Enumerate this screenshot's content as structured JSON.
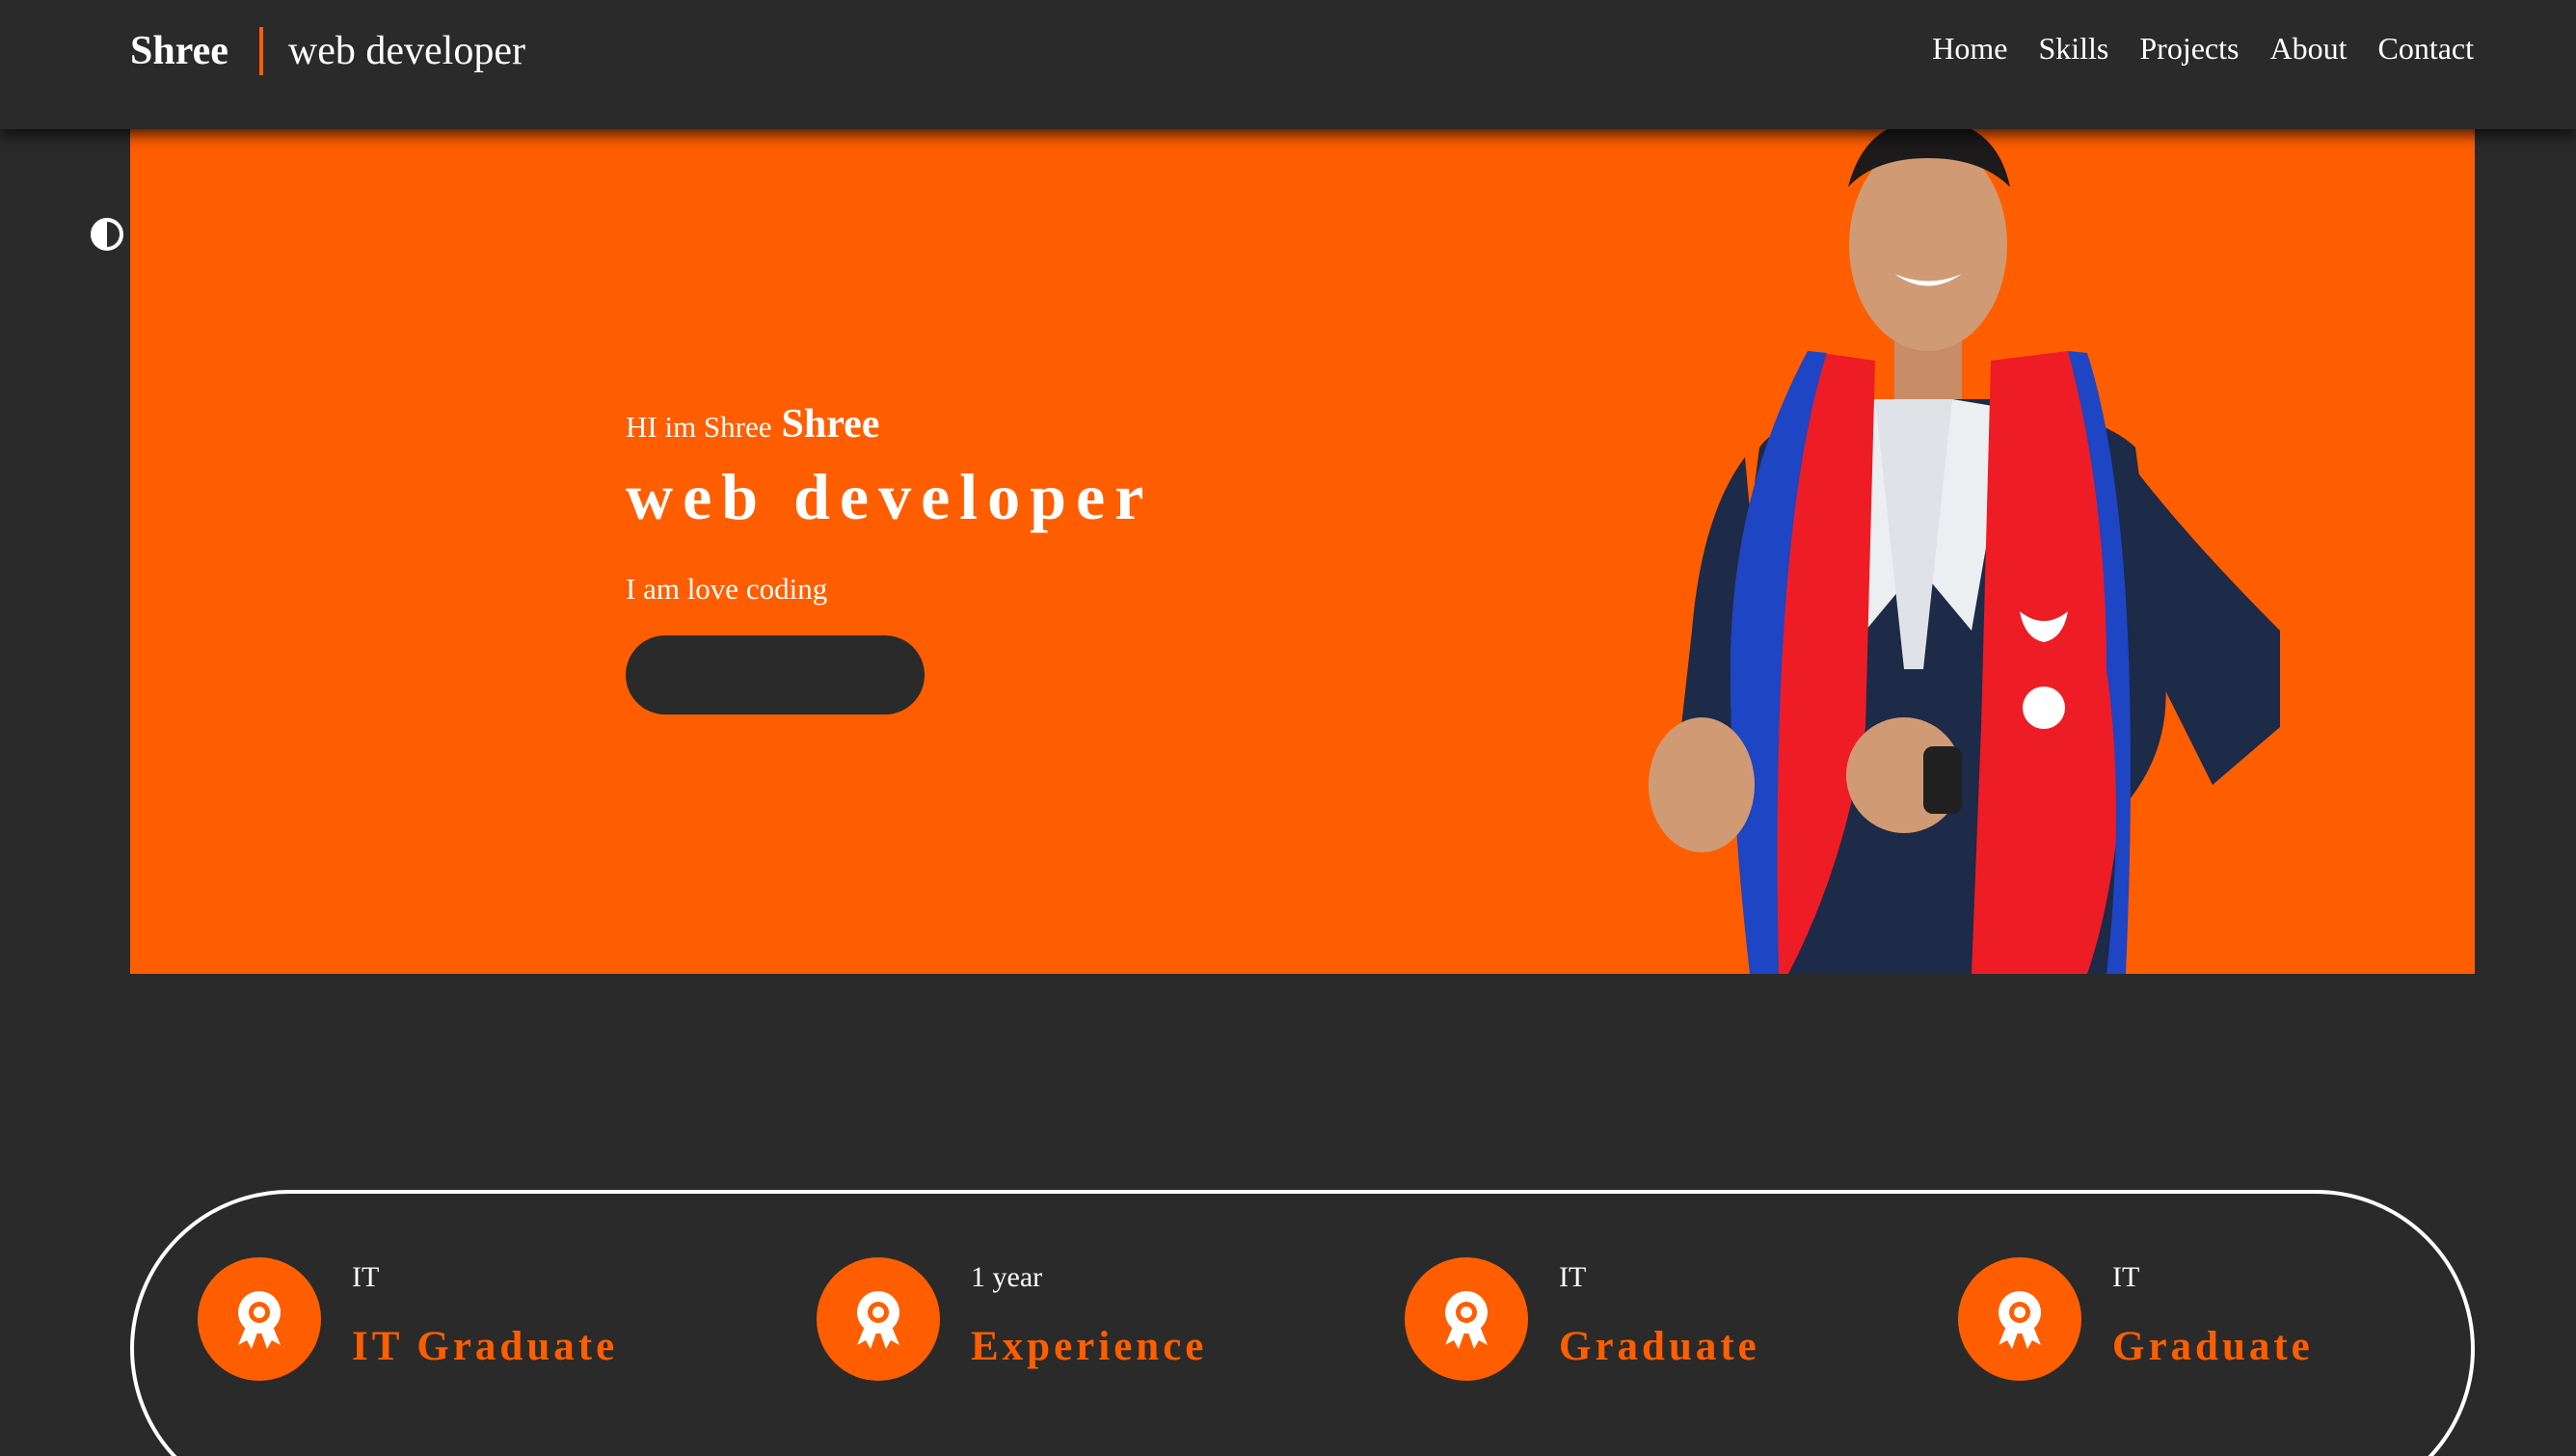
{
  "header": {
    "brand_name": "Shree",
    "brand_role": "web developer",
    "nav": [
      "Home",
      "Skills",
      "Projects",
      "About",
      "Contact"
    ]
  },
  "theme_toggle_icon": "contrast-icon",
  "hero": {
    "greeting": "HI im Shree",
    "greeting_name": "Shree",
    "role": "web developer",
    "tagline": "I am love coding",
    "button_label": ""
  },
  "stats": [
    {
      "top": "IT",
      "title": "IT Graduate",
      "icon": "award-icon"
    },
    {
      "top": "1 year",
      "title": "Experience",
      "icon": "award-icon"
    },
    {
      "top": "IT",
      "title": "Graduate",
      "icon": "award-icon"
    },
    {
      "top": "IT",
      "title": "Graduate",
      "icon": "award-icon"
    }
  ],
  "colors": {
    "accent": "#ff5e00",
    "background": "#2a2a2a",
    "text": "#ffffff"
  }
}
